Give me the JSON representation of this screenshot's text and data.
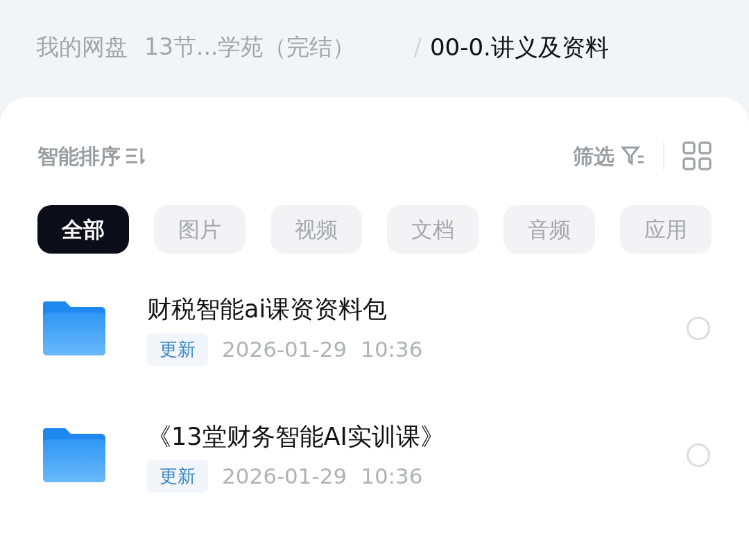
{
  "breadcrumb": [
    {
      "label": "我的网盘",
      "current": false
    },
    {
      "label": "13节...学苑（完结）",
      "current": false
    },
    {
      "label": "00-0.讲义及资料",
      "current": true
    }
  ],
  "separator": "/",
  "toolbar": {
    "sort": "智能排序",
    "filter": "筛选"
  },
  "chips": [
    {
      "label": "全部",
      "selected": true
    },
    {
      "label": "图片",
      "selected": false
    },
    {
      "label": "视频",
      "selected": false
    },
    {
      "label": "文档",
      "selected": false
    },
    {
      "label": "音频",
      "selected": false
    },
    {
      "label": "应用",
      "selected": false
    }
  ],
  "files": [
    {
      "name": "财税智能ai课资资料包",
      "tag": "更新",
      "date": "2026-01-29",
      "time": "10:36",
      "checked": false
    },
    {
      "name": "《13堂财务智能AI实训课》",
      "tag": "更新",
      "date": "2026-01-29",
      "time": "10:36",
      "checked": false
    }
  ]
}
